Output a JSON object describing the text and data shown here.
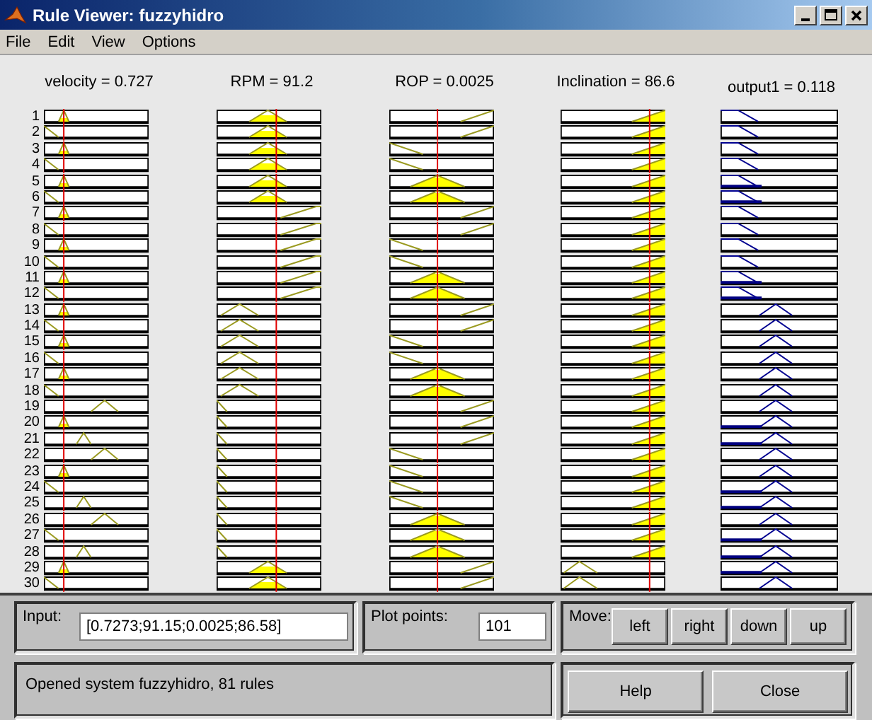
{
  "window": {
    "title": "Rule Viewer: fuzzyhidro"
  },
  "menu": [
    "File",
    "Edit",
    "View",
    "Options"
  ],
  "headers": [
    "velocity = 0.727",
    "RPM = 91.2",
    "ROP = 0.0025",
    "Inclination = 86.6",
    "output1 = 0.118"
  ],
  "rules": [
    {
      "number": "1",
      "cells": [
        {
          "kind": "b",
          "fired": true
        },
        {
          "kind": "c",
          "fired": true
        },
        {
          "kind": "d",
          "fired": false
        },
        {
          "kind": "d",
          "fired": true
        },
        {
          "kind": "a",
          "fired": false
        }
      ]
    },
    {
      "number": "2",
      "cells": [
        {
          "kind": "a",
          "fired": false
        },
        {
          "kind": "c",
          "fired": true
        },
        {
          "kind": "d",
          "fired": false
        },
        {
          "kind": "d",
          "fired": true
        },
        {
          "kind": "a",
          "fired": false
        }
      ]
    },
    {
      "number": "3",
      "cells": [
        {
          "kind": "b",
          "fired": true
        },
        {
          "kind": "c",
          "fired": true
        },
        {
          "kind": "a",
          "fired": false
        },
        {
          "kind": "d",
          "fired": true
        },
        {
          "kind": "a",
          "fired": false
        }
      ]
    },
    {
      "number": "4",
      "cells": [
        {
          "kind": "a",
          "fired": false
        },
        {
          "kind": "c",
          "fired": true
        },
        {
          "kind": "a",
          "fired": false
        },
        {
          "kind": "d",
          "fired": true
        },
        {
          "kind": "a",
          "fired": false
        }
      ]
    },
    {
      "number": "5",
      "cells": [
        {
          "kind": "b",
          "fired": true
        },
        {
          "kind": "c",
          "fired": true
        },
        {
          "kind": "c",
          "fired": true
        },
        {
          "kind": "d",
          "fired": true
        },
        {
          "kind": "a",
          "fired": true
        }
      ]
    },
    {
      "number": "6",
      "cells": [
        {
          "kind": "a",
          "fired": false
        },
        {
          "kind": "c",
          "fired": true
        },
        {
          "kind": "c",
          "fired": true
        },
        {
          "kind": "d",
          "fired": true
        },
        {
          "kind": "a",
          "fired": true
        }
      ]
    },
    {
      "number": "7",
      "cells": [
        {
          "kind": "b",
          "fired": true
        },
        {
          "kind": "d",
          "fired": false
        },
        {
          "kind": "d",
          "fired": false
        },
        {
          "kind": "d",
          "fired": true
        },
        {
          "kind": "a",
          "fired": false
        }
      ]
    },
    {
      "number": "8",
      "cells": [
        {
          "kind": "a",
          "fired": false
        },
        {
          "kind": "d",
          "fired": false
        },
        {
          "kind": "d",
          "fired": false
        },
        {
          "kind": "d",
          "fired": true
        },
        {
          "kind": "a",
          "fired": false
        }
      ]
    },
    {
      "number": "9",
      "cells": [
        {
          "kind": "b",
          "fired": true
        },
        {
          "kind": "d",
          "fired": false
        },
        {
          "kind": "a",
          "fired": false
        },
        {
          "kind": "d",
          "fired": true
        },
        {
          "kind": "a",
          "fired": false
        }
      ]
    },
    {
      "number": "10",
      "cells": [
        {
          "kind": "a",
          "fired": false
        },
        {
          "kind": "d",
          "fired": false
        },
        {
          "kind": "a",
          "fired": false
        },
        {
          "kind": "d",
          "fired": true
        },
        {
          "kind": "a",
          "fired": false
        }
      ]
    },
    {
      "number": "11",
      "cells": [
        {
          "kind": "b",
          "fired": true
        },
        {
          "kind": "d",
          "fired": false
        },
        {
          "kind": "c",
          "fired": true
        },
        {
          "kind": "d",
          "fired": true
        },
        {
          "kind": "a",
          "fired": true
        }
      ]
    },
    {
      "number": "12",
      "cells": [
        {
          "kind": "a",
          "fired": false
        },
        {
          "kind": "d",
          "fired": false
        },
        {
          "kind": "c",
          "fired": true
        },
        {
          "kind": "d",
          "fired": true
        },
        {
          "kind": "a",
          "fired": true
        }
      ]
    },
    {
      "number": "13",
      "cells": [
        {
          "kind": "b",
          "fired": true
        },
        {
          "kind": "b",
          "fired": false
        },
        {
          "kind": "d",
          "fired": false
        },
        {
          "kind": "d",
          "fired": true
        },
        {
          "kind": "b",
          "fired": false
        }
      ]
    },
    {
      "number": "14",
      "cells": [
        {
          "kind": "a",
          "fired": false
        },
        {
          "kind": "b",
          "fired": false
        },
        {
          "kind": "d",
          "fired": false
        },
        {
          "kind": "d",
          "fired": true
        },
        {
          "kind": "b",
          "fired": false
        }
      ]
    },
    {
      "number": "15",
      "cells": [
        {
          "kind": "b",
          "fired": true
        },
        {
          "kind": "b",
          "fired": false
        },
        {
          "kind": "a",
          "fired": false
        },
        {
          "kind": "d",
          "fired": true
        },
        {
          "kind": "b",
          "fired": false
        }
      ]
    },
    {
      "number": "16",
      "cells": [
        {
          "kind": "a",
          "fired": false
        },
        {
          "kind": "b",
          "fired": false
        },
        {
          "kind": "a",
          "fired": false
        },
        {
          "kind": "d",
          "fired": true
        },
        {
          "kind": "b",
          "fired": false
        }
      ]
    },
    {
      "number": "17",
      "cells": [
        {
          "kind": "b",
          "fired": true
        },
        {
          "kind": "b",
          "fired": false
        },
        {
          "kind": "c",
          "fired": true
        },
        {
          "kind": "d",
          "fired": true
        },
        {
          "kind": "b",
          "fired": false
        }
      ]
    },
    {
      "number": "18",
      "cells": [
        {
          "kind": "a",
          "fired": false
        },
        {
          "kind": "b",
          "fired": false
        },
        {
          "kind": "c",
          "fired": true
        },
        {
          "kind": "d",
          "fired": true
        },
        {
          "kind": "b",
          "fired": false
        }
      ]
    },
    {
      "number": "19",
      "cells": [
        {
          "kind": "d",
          "fired": false
        },
        {
          "kind": "a",
          "fired": false
        },
        {
          "kind": "d",
          "fired": false
        },
        {
          "kind": "d",
          "fired": true
        },
        {
          "kind": "b",
          "fired": false
        }
      ]
    },
    {
      "number": "20",
      "cells": [
        {
          "kind": "b",
          "fired": true
        },
        {
          "kind": "a",
          "fired": false
        },
        {
          "kind": "d",
          "fired": false
        },
        {
          "kind": "d",
          "fired": true
        },
        {
          "kind": "b",
          "fired": true
        }
      ]
    },
    {
      "number": "21",
      "cells": [
        {
          "kind": "c",
          "fired": false
        },
        {
          "kind": "a",
          "fired": false
        },
        {
          "kind": "d",
          "fired": false
        },
        {
          "kind": "d",
          "fired": true
        },
        {
          "kind": "b",
          "fired": true
        }
      ]
    },
    {
      "number": "22",
      "cells": [
        {
          "kind": "d",
          "fired": false
        },
        {
          "kind": "a",
          "fired": false
        },
        {
          "kind": "a",
          "fired": false
        },
        {
          "kind": "d",
          "fired": true
        },
        {
          "kind": "b",
          "fired": false
        }
      ]
    },
    {
      "number": "23",
      "cells": [
        {
          "kind": "b",
          "fired": true
        },
        {
          "kind": "a",
          "fired": false
        },
        {
          "kind": "a",
          "fired": false
        },
        {
          "kind": "d",
          "fired": true
        },
        {
          "kind": "b",
          "fired": false
        }
      ]
    },
    {
      "number": "24",
      "cells": [
        {
          "kind": "a",
          "fired": false
        },
        {
          "kind": "a",
          "fired": false
        },
        {
          "kind": "a",
          "fired": false
        },
        {
          "kind": "d",
          "fired": true
        },
        {
          "kind": "b",
          "fired": true
        }
      ]
    },
    {
      "number": "25",
      "cells": [
        {
          "kind": "c",
          "fired": false
        },
        {
          "kind": "a",
          "fired": false
        },
        {
          "kind": "a",
          "fired": false
        },
        {
          "kind": "d",
          "fired": true
        },
        {
          "kind": "b",
          "fired": true
        }
      ]
    },
    {
      "number": "26",
      "cells": [
        {
          "kind": "d",
          "fired": false
        },
        {
          "kind": "a",
          "fired": false
        },
        {
          "kind": "c",
          "fired": true
        },
        {
          "kind": "d",
          "fired": true
        },
        {
          "kind": "b",
          "fired": false
        }
      ]
    },
    {
      "number": "27",
      "cells": [
        {
          "kind": "a",
          "fired": false
        },
        {
          "kind": "a",
          "fired": false
        },
        {
          "kind": "c",
          "fired": true
        },
        {
          "kind": "d",
          "fired": true
        },
        {
          "kind": "b",
          "fired": true
        }
      ]
    },
    {
      "number": "28",
      "cells": [
        {
          "kind": "c",
          "fired": false
        },
        {
          "kind": "a",
          "fired": false
        },
        {
          "kind": "c",
          "fired": true
        },
        {
          "kind": "d",
          "fired": true
        },
        {
          "kind": "b",
          "fired": true
        }
      ]
    },
    {
      "number": "29",
      "cells": [
        {
          "kind": "b",
          "fired": true
        },
        {
          "kind": "c",
          "fired": true
        },
        {
          "kind": "d",
          "fired": false
        },
        {
          "kind": "a",
          "fired": false
        },
        {
          "kind": "b",
          "fired": true
        }
      ]
    },
    {
      "number": "30",
      "cells": [
        {
          "kind": "a",
          "fired": false
        },
        {
          "kind": "c",
          "fired": true
        },
        {
          "kind": "d",
          "fired": false
        },
        {
          "kind": "a",
          "fired": false
        },
        {
          "kind": "b",
          "fired": false
        }
      ]
    }
  ],
  "input": {
    "label": "Input:",
    "value": "[0.7273;91.15;0.0025;86.58]"
  },
  "plot_points": {
    "label": "Plot points:",
    "value": "101"
  },
  "move": {
    "label": "Move:",
    "buttons": [
      "left",
      "right",
      "down",
      "up"
    ]
  },
  "status": "Opened system fuzzyhidro, 81 rules",
  "buttons": [
    "Help",
    "Close"
  ]
}
